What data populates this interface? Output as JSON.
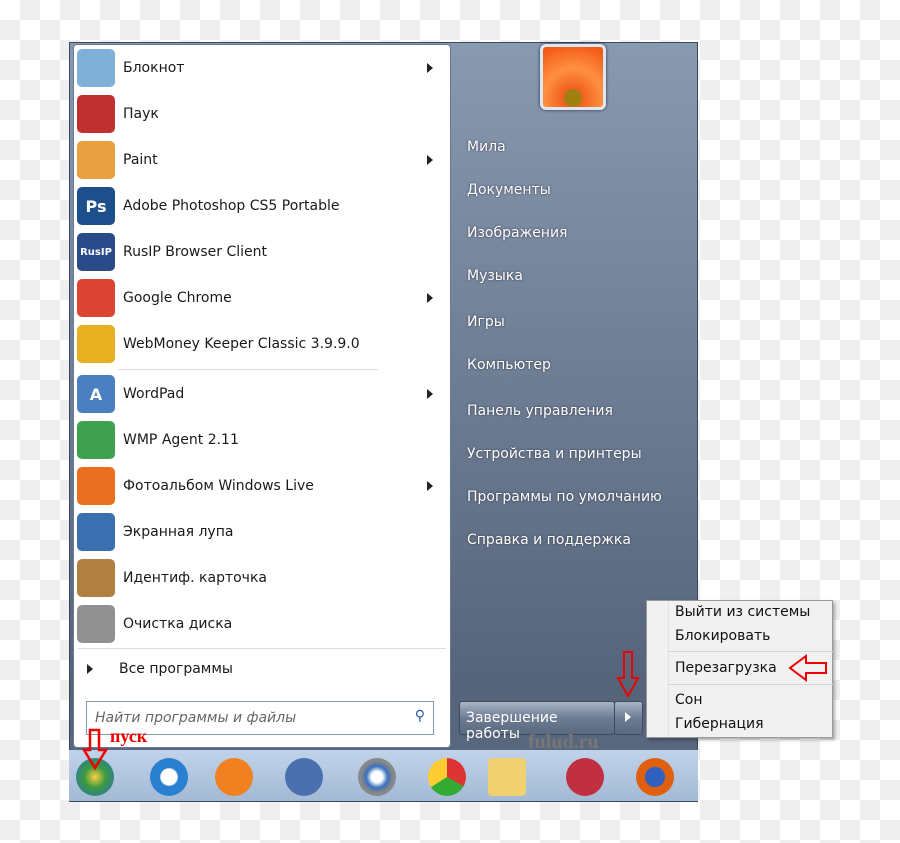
{
  "programs": [
    {
      "label": "Блокнот",
      "icon": "notepad-icon",
      "color": "#7fb0d8",
      "submenu": true
    },
    {
      "label": "Паук",
      "icon": "spider-solitaire-icon",
      "color": "#c03030",
      "submenu": false
    },
    {
      "label": "Paint",
      "icon": "paint-icon",
      "color": "#e8a040",
      "submenu": true
    },
    {
      "label": "Adobe Photoshop CS5 Portable",
      "icon": "photoshop-icon",
      "color": "#1d4f8c",
      "glyph": "Ps",
      "submenu": false
    },
    {
      "label": "RusIP Browser Client",
      "icon": "rusip-icon",
      "color": "#2a4a8a",
      "glyph": "RusIP",
      "submenu": false
    },
    {
      "label": "Google Chrome",
      "icon": "chrome-icon",
      "color": "#dd4433",
      "submenu": true
    },
    {
      "label": "WebMoney Keeper Classic 3.9.9.0",
      "icon": "webmoney-icon",
      "color": "#e8b020",
      "submenu": false
    },
    {
      "label": "WordPad",
      "icon": "wordpad-icon",
      "color": "#4a80c0",
      "glyph": "A",
      "submenu": true
    },
    {
      "label": "WMP Agent 2.11",
      "icon": "wmp-agent-icon",
      "color": "#40a050",
      "submenu": false
    },
    {
      "label": "Фотоальбом Windows Live",
      "icon": "photo-gallery-icon",
      "color": "#e87020",
      "submenu": true
    },
    {
      "label": "Экранная лупа",
      "icon": "magnifier-icon",
      "color": "#3a70b0",
      "submenu": false
    },
    {
      "label": "Идентиф. карточка",
      "icon": "id-card-icon",
      "color": "#b08040",
      "submenu": false
    },
    {
      "label": "Очистка диска",
      "icon": "disk-cleanup-icon",
      "color": "#909090",
      "submenu": false
    }
  ],
  "all_programs": "Все программы",
  "search_placeholder": "Найти программы и файлы",
  "right_items": [
    "Мила",
    "Документы",
    "Изображения",
    "Музыка",
    "Игры",
    "Компьютер",
    "Панель управления",
    "Устройства и принтеры",
    "Программы по умолчанию",
    "Справка и поддержка"
  ],
  "shutdown_label": "Завершение работы",
  "shutdown_menu": [
    "Выйти из системы",
    "Блокировать",
    "Перезагрузка",
    "Сон",
    "Гибернация"
  ],
  "annotation_start": "пуск",
  "watermark": "fulud.ru",
  "taskbar_icons": [
    "start-orb-icon",
    "internet-explorer-icon",
    "media-player-icon",
    "user-app-icon",
    "safari-icon",
    "chrome-icon",
    "explorer-icon",
    "vip-ip-icon",
    "firefox-icon"
  ],
  "colors": {
    "annotation": "#e00000",
    "accent": "#55647a"
  }
}
